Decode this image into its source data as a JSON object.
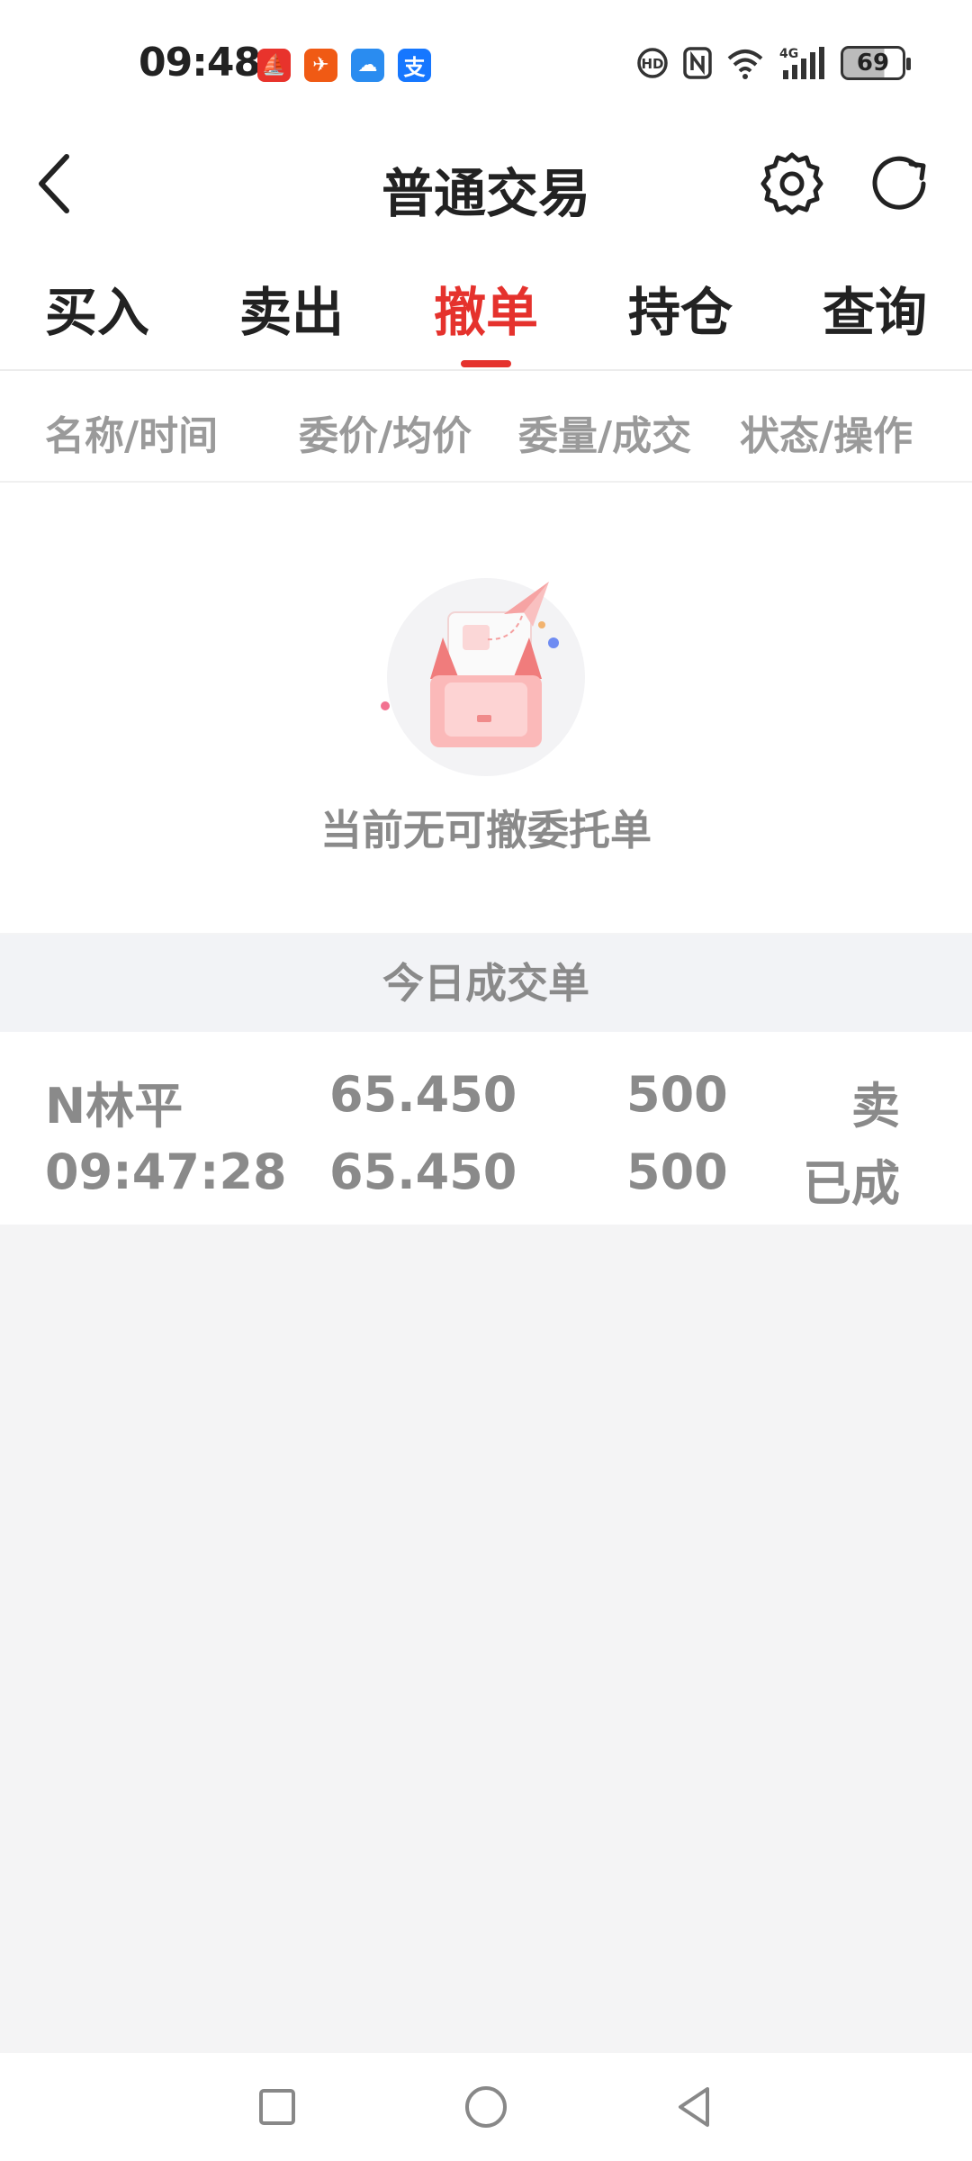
{
  "status_bar": {
    "time": "09:48",
    "apps": [
      {
        "icon": "securities-app-icon",
        "color": "#e8332c",
        "glyph": "⛵"
      },
      {
        "icon": "paper-plane-app-icon",
        "color": "#f05a14",
        "glyph": "✈"
      },
      {
        "icon": "weather-app-icon",
        "color": "#2a8cf0",
        "glyph": "☁"
      },
      {
        "icon": "alipay-app-icon",
        "color": "#1677ff",
        "glyph": "支"
      }
    ],
    "battery": "69"
  },
  "header": {
    "title": "普通交易"
  },
  "tabs": [
    {
      "label": "买入",
      "active": false
    },
    {
      "label": "卖出",
      "active": false
    },
    {
      "label": "撤单",
      "active": true
    },
    {
      "label": "持仓",
      "active": false
    },
    {
      "label": "查询",
      "active": false
    }
  ],
  "columns": [
    "名称/时间",
    "委价/均价",
    "委量/成交",
    "状态/操作"
  ],
  "empty_state": {
    "message": "当前无可撤委托单"
  },
  "today_deals": {
    "title": "今日成交单",
    "rows": [
      {
        "name": "N林平",
        "time": "09:47:28",
        "order_price": "65.450",
        "avg_price": "65.450",
        "order_qty": "500",
        "filled_qty": "500",
        "direction": "卖",
        "status": "已成"
      }
    ]
  },
  "colors": {
    "accent": "#e5322d",
    "muted_text": "#8a8a8a"
  }
}
